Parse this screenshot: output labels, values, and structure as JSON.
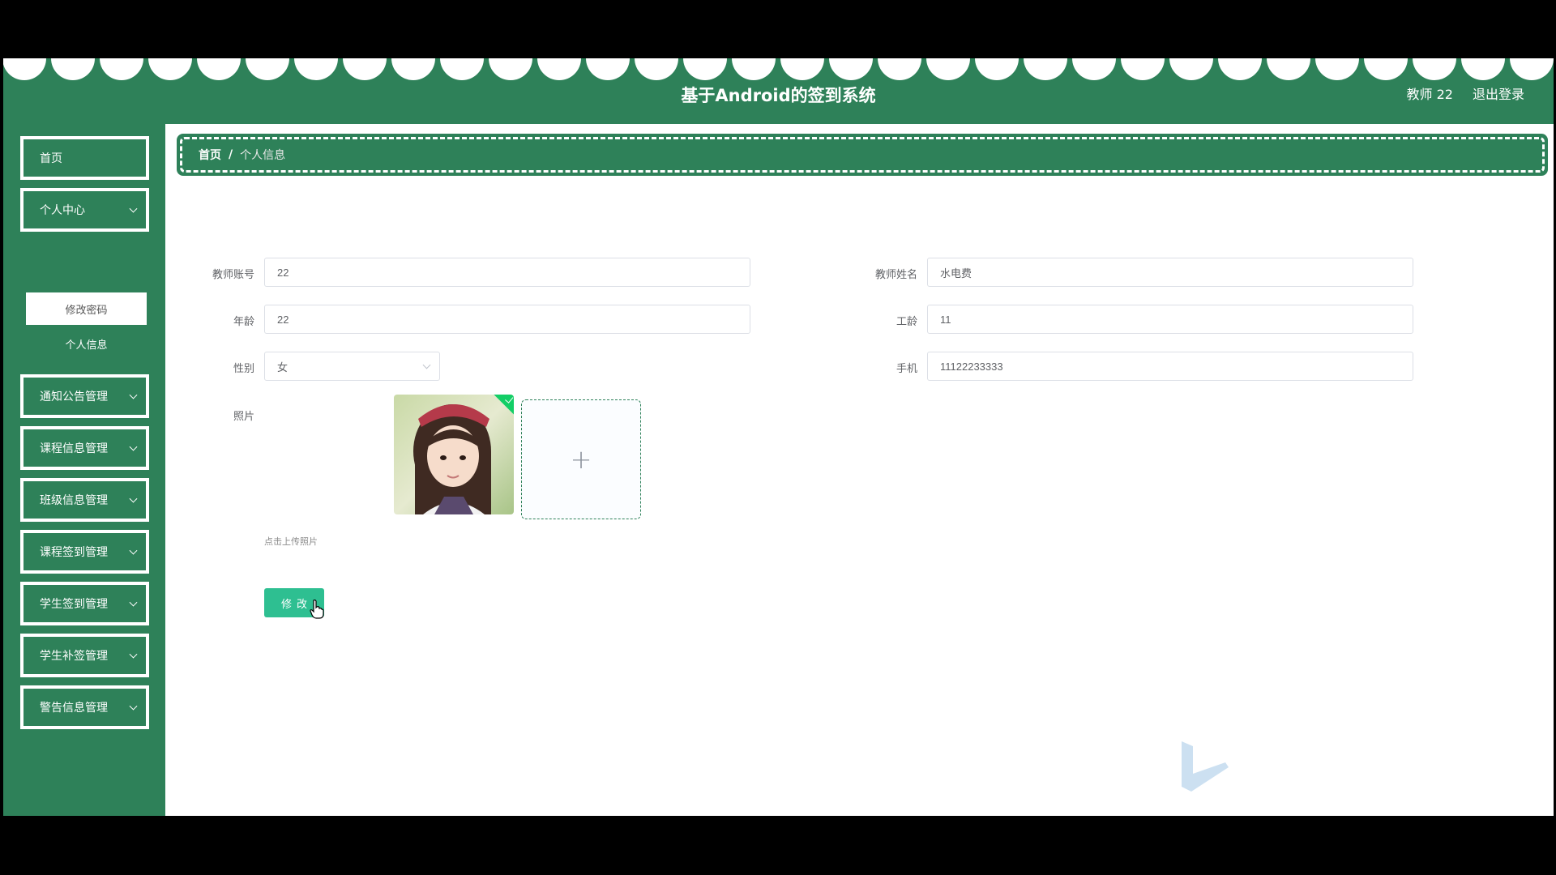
{
  "header": {
    "title": "基于Android的签到系统",
    "user_label": "教师 22",
    "logout_label": "退出登录"
  },
  "sidebar": {
    "items": [
      {
        "label": "首页",
        "has_chevron": false
      },
      {
        "label": "个人中心",
        "has_chevron": true
      },
      {
        "label": "通知公告管理",
        "has_chevron": true
      },
      {
        "label": "课程信息管理",
        "has_chevron": true
      },
      {
        "label": "班级信息管理",
        "has_chevron": true
      },
      {
        "label": "课程签到管理",
        "has_chevron": true
      },
      {
        "label": "学生签到管理",
        "has_chevron": true
      },
      {
        "label": "学生补签管理",
        "has_chevron": true
      },
      {
        "label": "警告信息管理",
        "has_chevron": true
      }
    ],
    "submenu": [
      {
        "label": "修改密码",
        "active": true
      },
      {
        "label": "个人信息",
        "active": false
      }
    ]
  },
  "breadcrumb": {
    "home": "首页",
    "separator": "/",
    "current": "个人信息"
  },
  "form": {
    "teacher_account": {
      "label": "教师账号",
      "value": "22"
    },
    "teacher_name": {
      "label": "教师姓名",
      "value": "水电费"
    },
    "age": {
      "label": "年龄",
      "value": "22"
    },
    "work_years": {
      "label": "工龄",
      "value": "11"
    },
    "gender": {
      "label": "性别",
      "value": "女"
    },
    "phone": {
      "label": "手机",
      "value": "11122233333"
    },
    "photo": {
      "label": "照片",
      "hint": "点击上传照片",
      "upload_icon": "+"
    },
    "submit_label": "修改"
  },
  "colors": {
    "brand_green": "#2e8159",
    "button_green": "#2ebf91",
    "upload_check": "#13ce66"
  },
  "icons": {
    "dropdown": "chevron-down-icon",
    "upload": "plus-icon",
    "cursor": "hand-pointer-icon"
  }
}
